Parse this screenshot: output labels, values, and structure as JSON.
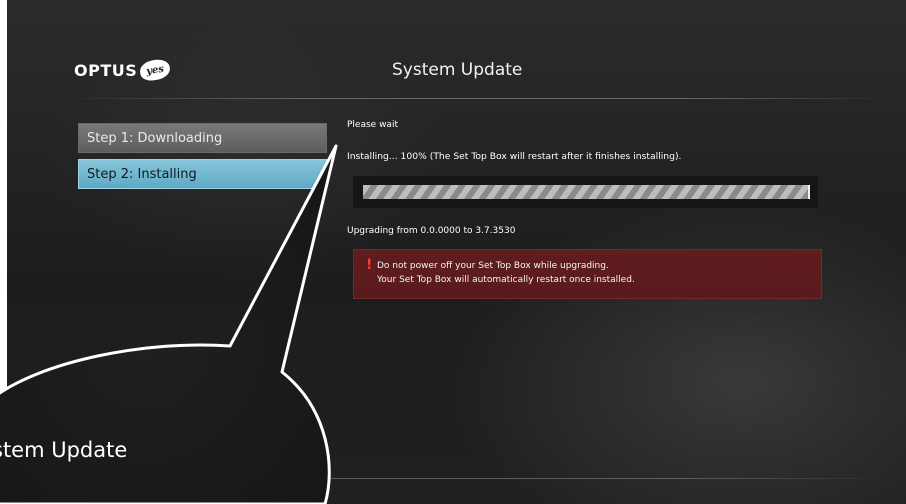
{
  "brand": {
    "name": "OPTUS",
    "badge": "yes"
  },
  "header": {
    "title": "System Update"
  },
  "steps": [
    {
      "label": "Step 1: Downloading",
      "state": "done"
    },
    {
      "label": "Step 2: Installing",
      "state": "active"
    }
  ],
  "status": {
    "wait_text": "Please wait",
    "installing_text": "Installing... 100% (The Set Top Box will restart after it finishes installing).",
    "progress_percent": 100,
    "upgrade_text": "Upgrading from 0.0.0000 to 3.7.3530"
  },
  "warning": {
    "icon": "exclamation-icon",
    "line1": "Do not power off your Set Top Box while upgrading.",
    "line2": "Your Set Top Box will automatically restart once installed."
  },
  "callout": {
    "text": "stem Update"
  },
  "colors": {
    "accent_active_step": "#6fb7cf",
    "warning_bg": "#5d1c1e",
    "warning_icon": "#ff3b3b"
  }
}
